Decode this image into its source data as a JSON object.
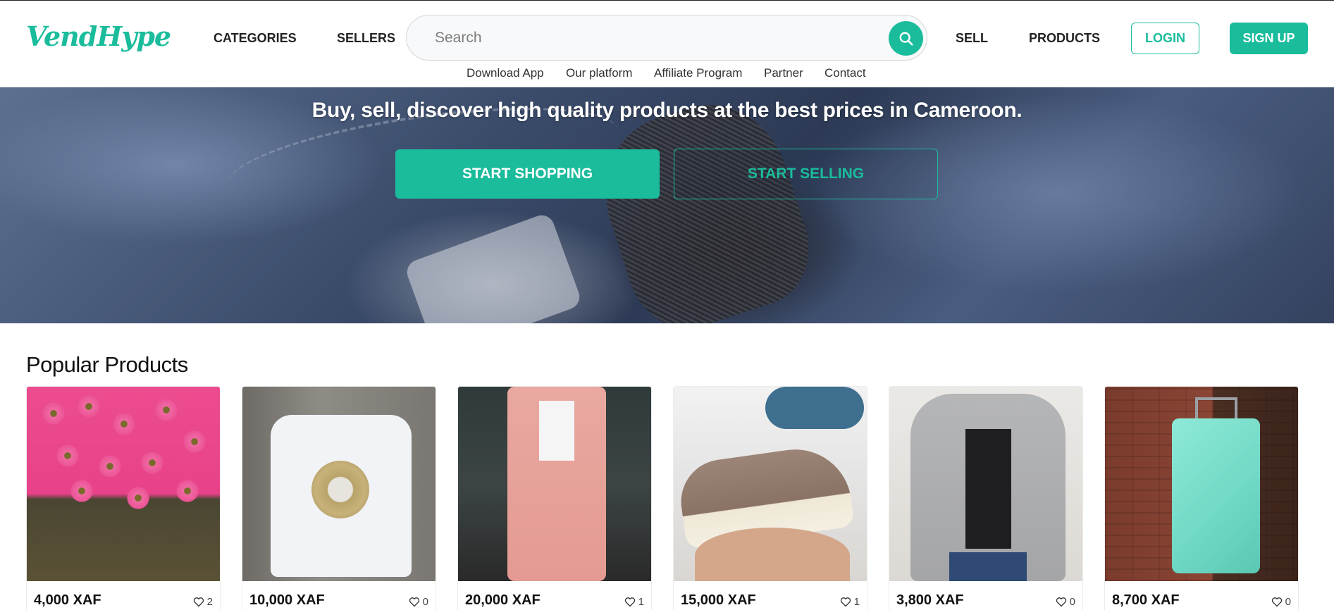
{
  "header": {
    "logo_text": "VendHype",
    "nav": {
      "categories": "CATEGORIES",
      "sellers": "SELLERS",
      "sell": "SELL",
      "products": "PRODUCTS"
    },
    "search": {
      "placeholder": "Search",
      "value": ""
    },
    "sub_links": [
      "Download App",
      "Our platform",
      "Affiliate Program",
      "Partner",
      "Contact"
    ],
    "login_label": "LOGIN",
    "signup_label": "SIGN UP"
  },
  "hero": {
    "tagline": "Buy, sell, discover high quality products at the best prices in Cameroon.",
    "start_shopping_label": "START SHOPPING",
    "start_selling_label": "START SELLING"
  },
  "popular": {
    "title": "Popular Products",
    "products": [
      {
        "price": "4,000 XAF",
        "likes": "2",
        "icon": "heart-icon"
      },
      {
        "price": "10,000 XAF",
        "likes": "0",
        "icon": "heart-icon"
      },
      {
        "price": "20,000 XAF",
        "likes": "1",
        "icon": "heart-icon"
      },
      {
        "price": "15,000 XAF",
        "likes": "1",
        "icon": "heart-icon"
      },
      {
        "price": "3,800 XAF",
        "likes": "0",
        "icon": "heart-icon"
      },
      {
        "price": "8,700 XAF",
        "likes": "0",
        "icon": "heart-icon"
      }
    ]
  },
  "colors": {
    "accent": "#1abc9c",
    "text": "#1d1d1d"
  }
}
